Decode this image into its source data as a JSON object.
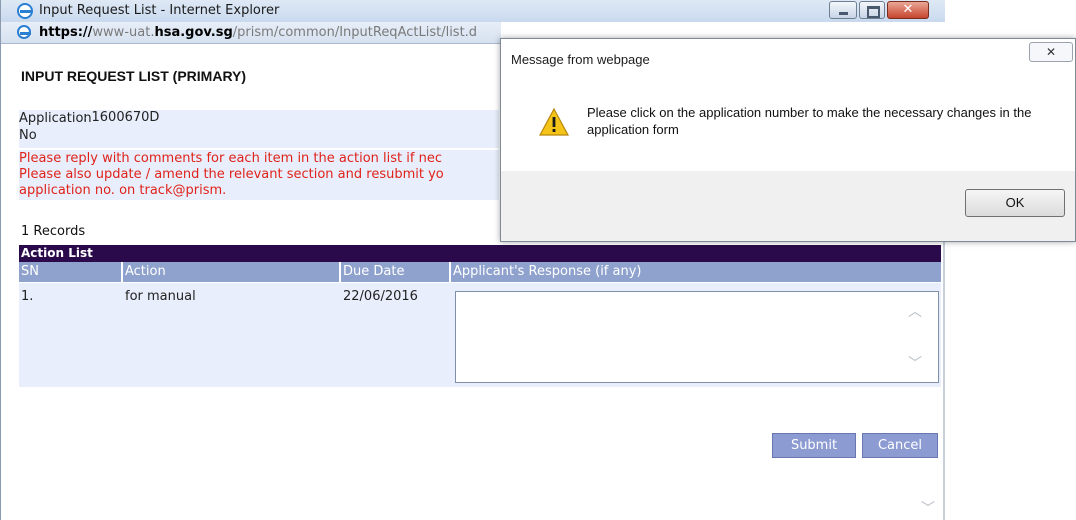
{
  "browser": {
    "title": "Input Request List - Internet Explorer",
    "url_prefix": "https://",
    "url_dim_1": "www-uat.",
    "url_domain": "hsa.gov.sg",
    "url_path": "/prism/common/InputReqActList/list.d"
  },
  "page": {
    "title": "INPUT REQUEST LIST (PRIMARY)",
    "application_label": "Application No",
    "application_value": ": 1600670D",
    "notice_lines": [
      "Please reply with comments for each item in the action list if nec",
      "Please also update / amend the relevant section and resubmit yo",
      "application no. on track@prism."
    ],
    "records": "1 Records",
    "action_list_title": "Action List",
    "columns": [
      "SN",
      "Action",
      "Due Date",
      "Applicant's Response (if any)"
    ],
    "rows": [
      {
        "sn": "1.",
        "action": "for manual",
        "due_date": "22/06/2016",
        "response": ""
      }
    ],
    "submit_label": "Submit",
    "cancel_label": "Cancel"
  },
  "dialog": {
    "title": "Message from webpage",
    "message": "Please click on the application number to make the necessary changes in the application form",
    "ok_label": "OK",
    "icon": "warning-icon"
  },
  "colors": {
    "action_list_bar": "#2a0a4a",
    "column_header": "#8fa2cd",
    "notice_text": "#e0231a",
    "button": "#8c9bd1"
  }
}
